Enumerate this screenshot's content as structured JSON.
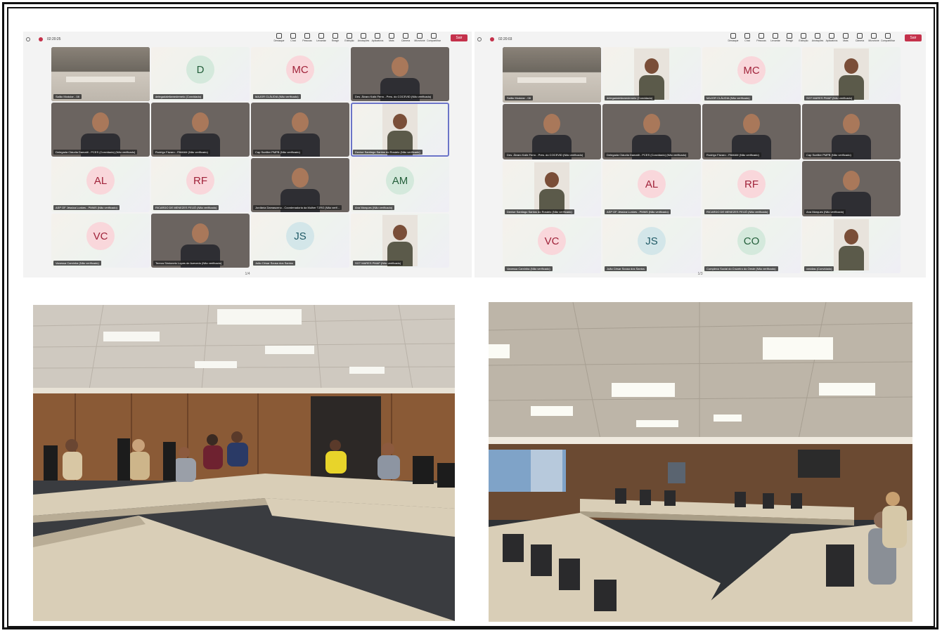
{
  "meetings": [
    {
      "id": "left",
      "timer": "02:20:25",
      "toolbar": [
        "Destaque",
        "Chat",
        "Pessoas",
        "Levantar",
        "Reagir",
        "Exibição",
        "Anotações",
        "Aplicativos",
        "Mais",
        "Câmera",
        "Microfone",
        "Compartilhar"
      ],
      "people_count": "16",
      "leave_label": "Sair",
      "pager": "1/4",
      "tiles": [
        {
          "kind": "room",
          "name": "Salão Modular - 08"
        },
        {
          "kind": "avatar",
          "initials": "D",
          "color": "green",
          "name": "delegadaleilamedemelo (Convidado)"
        },
        {
          "kind": "avatar",
          "initials": "MC",
          "color": "pink",
          "name": "MAJOR CLÁUDIA (Não verificado)"
        },
        {
          "kind": "video",
          "name": "Des. Álvaro Kalix Ferro - Pres. do COCEVID (Não verificado)"
        },
        {
          "kind": "video",
          "name": "Delegada Cláudia Damatti - PCES (Convidado) (Não verificado)"
        },
        {
          "kind": "video",
          "name": "Rodrigo Fávaro - PAMAM (Não verificado)"
        },
        {
          "kind": "video",
          "name": "Cap Sueliter PMPB (Não verificado)"
        },
        {
          "kind": "portrait",
          "name": "Denise Santiago Santos do Rosário (Não verificado)"
        },
        {
          "kind": "avatar",
          "initials": "AL",
          "color": "pink",
          "name": "ASP OF Jéssica Lunkes - PMMS (Não verificado)"
        },
        {
          "kind": "avatar",
          "initials": "RF",
          "color": "pink",
          "name": "RICARDO DE MENEZES FEIJÓ (Não verificado)"
        },
        {
          "kind": "video",
          "name": "Jordânia Damasceno - Coordenadoria da Mulher TJRO (Não verif..."
        },
        {
          "kind": "avatar",
          "initials": "AM",
          "color": "green",
          "name": "Ana Marques (Não verificado)"
        },
        {
          "kind": "avatar",
          "initials": "VC",
          "color": "pink",
          "name": "Vanessa Caminha (Não verificado)"
        },
        {
          "kind": "video",
          "name": "Tereza Simioneto Lopes de Azevedo (Não verificado)"
        },
        {
          "kind": "avatar",
          "initials": "JS",
          "color": "teal",
          "name": "João César Sousa dos Santos"
        },
        {
          "kind": "portrait",
          "name": "SGT MARES PMAP (Não verificado)"
        }
      ]
    },
    {
      "id": "right",
      "timer": "02:20:03",
      "toolbar": [
        "Destaque",
        "Chat",
        "Pessoas",
        "Levantar",
        "Reagir",
        "Exibição",
        "Anotações",
        "Aplicativos",
        "Mais",
        "Câmera",
        "Microfone",
        "Compartilhar"
      ],
      "people_count": "40",
      "leave_label": "Sair",
      "pager": "1/3",
      "tiles": [
        {
          "kind": "room",
          "name": "Salão Modular - 08"
        },
        {
          "kind": "portrait",
          "name": "delegadaleilamedemelo (Convidado)"
        },
        {
          "kind": "avatar",
          "initials": "MC",
          "color": "pink",
          "name": "MAJOR CLÁUDIA (Não verificado)"
        },
        {
          "kind": "portrait",
          "name": "SGT MARES PMAP (Não verificado)"
        },
        {
          "kind": "video",
          "name": "Des. Álvaro Kalix Ferro - Pres. do COCEVID (Não verificado)"
        },
        {
          "kind": "video",
          "name": "Delegada Cláudia Damatti - PCES (Convidado) (Não verificado)"
        },
        {
          "kind": "video",
          "name": "Rodrigo Fávaro - PAMAM (Não verificado)"
        },
        {
          "kind": "video",
          "name": "Cap Sueliter PMPB (Não verificado)"
        },
        {
          "kind": "portrait",
          "name": "Denise Santiago Santos do Rosário (Não verificado)"
        },
        {
          "kind": "avatar",
          "initials": "AL",
          "color": "pink",
          "name": "ASP OF Jéssica Lunkes - PMMS (Não verificado)"
        },
        {
          "kind": "avatar",
          "initials": "RF",
          "color": "pink",
          "name": "RICARDO DE MENEZES FEIJÓ (Não verificado)"
        },
        {
          "kind": "video",
          "name": "Ana Marques (Não verificado)"
        },
        {
          "kind": "avatar",
          "initials": "VC",
          "color": "pink",
          "name": "Vanessa Caminha (Não verificado)"
        },
        {
          "kind": "avatar",
          "initials": "JS",
          "color": "teal",
          "name": "João César Sousa dos Santos"
        },
        {
          "kind": "avatar",
          "initials": "CO",
          "color": "green",
          "name": "Complexo Social do Cruzeiro do Oeste (Não verificado)"
        },
        {
          "kind": "portrait",
          "name": "vmidias (Convidado)"
        }
      ]
    }
  ],
  "colors": {
    "leave": "#c4314b",
    "selected_outline": "#6b74c8",
    "wood": "#8a5a36",
    "carpet": "#3a3c40",
    "table": "#d9ceb7"
  }
}
